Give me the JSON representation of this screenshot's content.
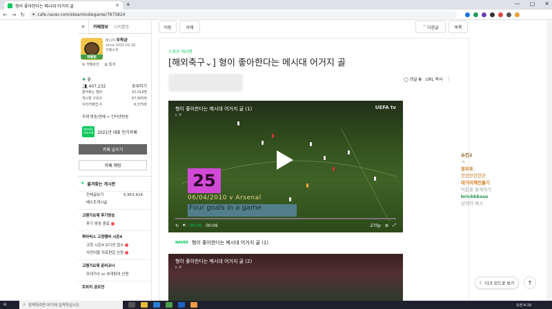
{
  "browser": {
    "tab_title": "형이 좋아한다는 메시대 어거지 골",
    "url": "cafe.naver.com/steamindiegame/7675824"
  },
  "sidebar": {
    "tab_info": "카페정보",
    "tab_activity": "나의활동",
    "manager_label": "매니저",
    "manager_name": "우왁굳",
    "since": "since 2015.02.26.",
    "cafe_intro": "카페소개",
    "manage": "카페관리",
    "stats_link": "통계",
    "level": "숲",
    "members": "407,232",
    "invite": "초대하기",
    "stat_rows": [
      {
        "k": "즐겨찾는 멤버",
        "v": "42,019명"
      },
      {
        "k": "게시판 구독수",
        "v": "67,905회"
      },
      {
        "k": "우리카페앱 수",
        "v": "6,375회"
      }
    ],
    "theme": "주제  방송/연예 > 인터넷방송",
    "badge_text": "NAVER 대표카페",
    "badge_label": "2021년 대표 인기카페",
    "write": "카페 글쓰기",
    "chat": "카페 채팅",
    "fav_header": "즐겨찾는 게시판",
    "fav_items": [
      {
        "k": "전체글보기",
        "v": "5,953,614"
      },
      {
        "k": "베스트게시글",
        "v": ""
      }
    ],
    "sec1": "고멤가요제 후기방송",
    "sec1_items": [
      "후기 방송 종료"
    ],
    "sec2": "왁타버스 고정멤버 시즌4",
    "sec2_items": [
      "고정 시즌4 오디션 접수",
      "사전어할 자료편집 신청"
    ],
    "sec3": "고멤가요제 준비코너",
    "sec3_items": [
      "조대가수 or 초대팀여 신청"
    ],
    "sec4": "트위치 공모전"
  },
  "toolbar": {
    "move": "이동",
    "delete": "삭제",
    "next": "다음글",
    "list": "목록"
  },
  "article": {
    "board": "스포츠 게시판",
    "title": "[해외축구⌄] 형이 좋아한다는 메시대 어거지 골",
    "comments_label": "댓글",
    "comments": "0",
    "copy_url": "URL 복사"
  },
  "video1": {
    "title": "형이 좋아한다는 메시대 어거지 골 (1)",
    "views": "0",
    "brand": "UEFA tv",
    "number": "25",
    "date": "06/04/2010 v Arsenal",
    "overlay": "Four goals in a game",
    "time_cur": "00:00",
    "time_total": "00:09",
    "quality": "270p",
    "progress": 0.0
  },
  "caption1": {
    "tag": "NAVER",
    "text": "형이 좋아한다는 메시대 어거지 골 (1)"
  },
  "video2": {
    "title": "형이 좋아한다는 메시대 어거지 골 (2)",
    "views": "0"
  },
  "chat": [
    {
      "name": "슈진2",
      "msg": "ㅋ",
      "color": "#8a6a2a"
    },
    {
      "name": "정두또",
      "msg": "한한한한한한",
      "color": "#c27a1a"
    },
    {
      "name": "대가리깨진돌기",
      "msg": "어둔을 들게야기",
      "color": "#d17a1a"
    },
    {
      "name": "brickbksso",
      "msg": "당하하 메시",
      "color": "#1f8f4a"
    }
  ],
  "dark_mode": "다크 모드로 보기",
  "taskbar": {
    "search": "검색하려면 여기에 입력하십시오",
    "time": "오전 4:19"
  }
}
